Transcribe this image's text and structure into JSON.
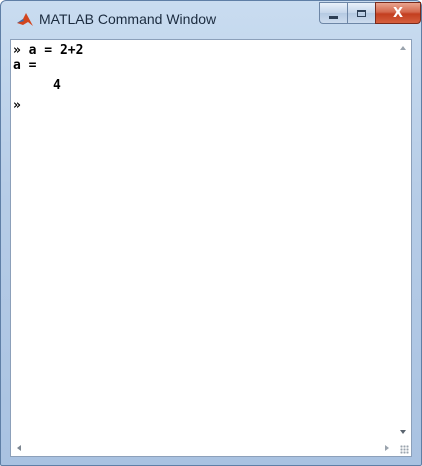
{
  "window": {
    "title": "MATLAB Command Window",
    "icon": "matlab-logo-icon",
    "controls": {
      "minimize_icon": "minimize-icon",
      "maximize_icon": "maximize-icon",
      "close_label": "X"
    }
  },
  "console": {
    "lines": [
      {
        "kind": "input",
        "text": "» a = 2+2"
      },
      {
        "kind": "output",
        "text": "a ="
      },
      {
        "kind": "value",
        "text": "4"
      },
      {
        "kind": "prompt",
        "text": "»"
      }
    ]
  },
  "colors": {
    "title_bar": "#b7cde7",
    "close_button": "#c33e1f",
    "console_bg": "#ffffff",
    "console_text": "#000000"
  }
}
